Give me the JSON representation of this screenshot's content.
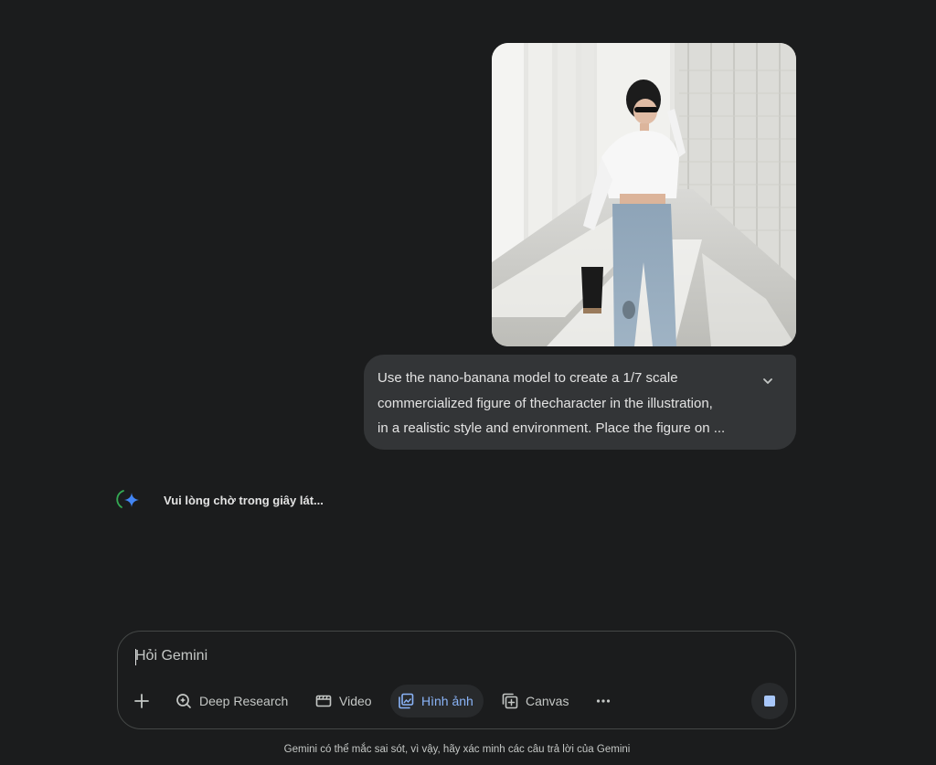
{
  "conversation": {
    "user_image": {
      "alt_icon": "uploaded-photo"
    },
    "user_prompt": {
      "lines": [
        "Use the nano-banana model to create a 1/7 scale",
        "commercialized figure of thecharacter in the illustration,",
        "in a realistic style and environment. Place the figure on ..."
      ],
      "expand_icon": "chevron-down-icon"
    },
    "status": {
      "icon": "gemini-spark-icon",
      "text": "Vui lòng chờ trong giây lát..."
    }
  },
  "composer": {
    "placeholder": "Hỏi Gemini",
    "tools": [
      {
        "id": "add",
        "label": "",
        "icon": "plus-icon"
      },
      {
        "id": "deep-research",
        "label": "Deep Research",
        "icon": "deep-research-icon"
      },
      {
        "id": "video",
        "label": "Video",
        "icon": "video-icon"
      },
      {
        "id": "image",
        "label": "Hình ảnh",
        "icon": "image-icon",
        "active": true
      },
      {
        "id": "canvas",
        "label": "Canvas",
        "icon": "canvas-icon"
      },
      {
        "id": "more",
        "label": "",
        "icon": "more-icon"
      }
    ],
    "stop_icon": "stop-icon"
  },
  "footer": {
    "disclaimer": "Gemini có thể mắc sai sót, vì vậy, hãy xác minh các câu trả lời của Gemini"
  },
  "colors": {
    "background": "#1b1c1d",
    "bubble": "#333537",
    "accent": "#8ab4f8",
    "text": "#e3e3e3",
    "muted": "#c4c7c5"
  }
}
